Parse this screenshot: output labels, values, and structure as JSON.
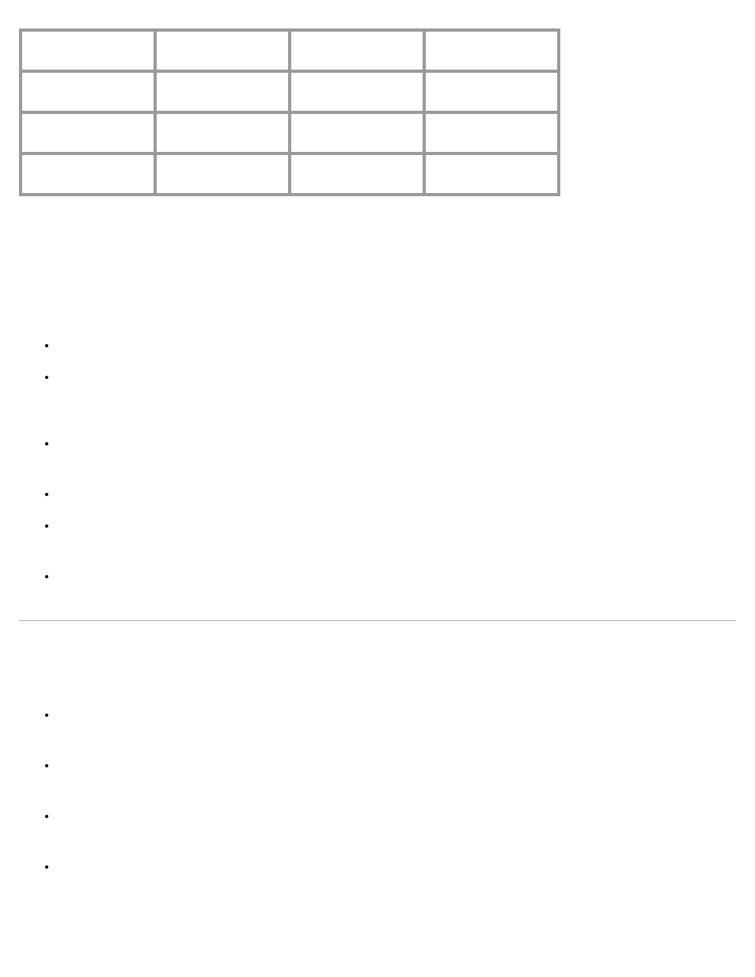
{
  "table": {
    "rows": [
      [
        "",
        "",
        "",
        ""
      ],
      [
        "",
        "",
        "",
        ""
      ],
      [
        "",
        "",
        "",
        ""
      ],
      [
        "",
        "",
        "",
        ""
      ]
    ]
  },
  "list1": {
    "items": [
      "",
      "",
      "",
      "",
      "",
      ""
    ]
  },
  "list2": {
    "items": [
      "",
      "",
      "",
      ""
    ]
  }
}
